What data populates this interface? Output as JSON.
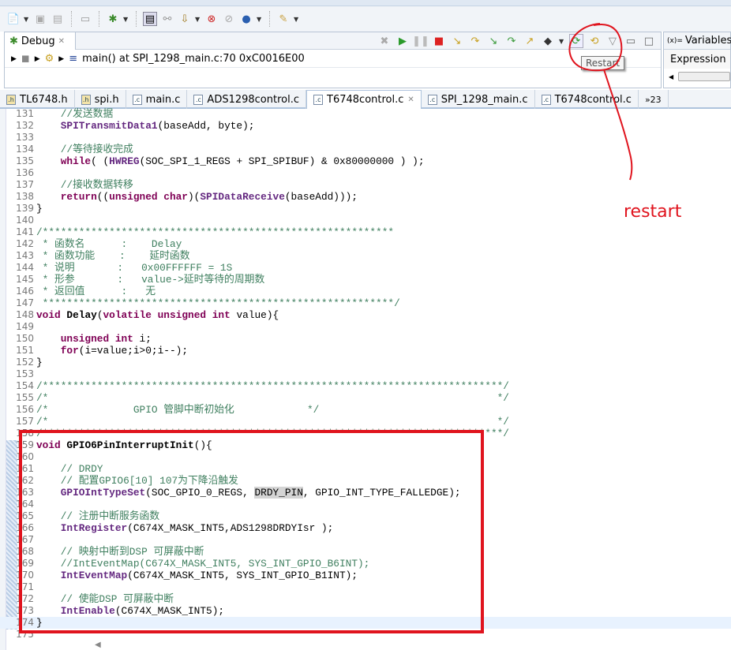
{
  "toolbar": {
    "icons": [
      "new-file-icon",
      "save-icon",
      "save-all-icon",
      "properties-icon",
      "debug-icon",
      "perspective-icon",
      "connect-icon",
      "load-program-icon",
      "breakpoint-icon",
      "disable-breakpoint-icon",
      "target-icon",
      "tools-icon"
    ]
  },
  "debug": {
    "title": "Debug",
    "stack_frame": "main() at SPI_1298_main.c:70 0xC0016E00",
    "restart_tooltip": "Restart"
  },
  "variables": {
    "title": "Variables",
    "column": "Expression"
  },
  "tabs": [
    {
      "label": "TL6748.h",
      "type": "h"
    },
    {
      "label": "spi.h",
      "type": "h"
    },
    {
      "label": "main.c",
      "type": "c"
    },
    {
      "label": "ADS1298control.c",
      "type": "c"
    },
    {
      "label": "T6748control.c",
      "type": "c",
      "active": true
    },
    {
      "label": "SPI_1298_main.c",
      "type": "c"
    },
    {
      "label": "T6748control.c",
      "type": "c"
    }
  ],
  "tabs_overflow": "»23",
  "code": [
    {
      "n": "131",
      "s": [
        [
          "c",
          "    //发送数据"
        ]
      ]
    },
    {
      "n": "132",
      "s": [
        [
          "t",
          "    "
        ],
        [
          "f",
          "SPITransmitData1"
        ],
        [
          "t",
          "(baseAdd, byte);"
        ]
      ]
    },
    {
      "n": "133",
      "s": []
    },
    {
      "n": "134",
      "s": [
        [
          "c",
          "    //等待接收完成"
        ]
      ]
    },
    {
      "n": "135",
      "s": [
        [
          "t",
          "    "
        ],
        [
          "k",
          "while"
        ],
        [
          "t",
          "( ("
        ],
        [
          "f",
          "HWREG"
        ],
        [
          "t",
          "(SOC_SPI_1_REGS + SPI_SPIBUF) & 0x80000000 ) );"
        ]
      ]
    },
    {
      "n": "136",
      "s": []
    },
    {
      "n": "137",
      "s": [
        [
          "c",
          "    //接收数据转移"
        ]
      ]
    },
    {
      "n": "138",
      "s": [
        [
          "t",
          "    "
        ],
        [
          "k",
          "return"
        ],
        [
          "t",
          "(("
        ],
        [
          "k",
          "unsigned char"
        ],
        [
          "t",
          ")("
        ],
        [
          "f",
          "SPIDataReceive"
        ],
        [
          "t",
          "(baseAdd)));"
        ]
      ]
    },
    {
      "n": "139",
      "s": [
        [
          "t",
          "}"
        ]
      ]
    },
    {
      "n": "140",
      "s": []
    },
    {
      "n": "141",
      "s": [
        [
          "c",
          "/**********************************************************"
        ]
      ]
    },
    {
      "n": "142",
      "s": [
        [
          "c",
          " * 函数名      :    Delay"
        ]
      ]
    },
    {
      "n": "143",
      "s": [
        [
          "c",
          " * 函数功能    :    延时函数"
        ]
      ]
    },
    {
      "n": "144",
      "s": [
        [
          "c",
          " * 说明       :   0x00FFFFFF = 1S"
        ]
      ]
    },
    {
      "n": "145",
      "s": [
        [
          "c",
          " * 形参       :   value->延时等待的周期数"
        ]
      ]
    },
    {
      "n": "146",
      "s": [
        [
          "c",
          " * 返回值      :   无"
        ]
      ]
    },
    {
      "n": "147",
      "s": [
        [
          "c",
          " **********************************************************/"
        ]
      ]
    },
    {
      "n": "148",
      "s": [
        [
          "k",
          "void"
        ],
        [
          "t",
          " "
        ],
        [
          "b",
          "Delay"
        ],
        [
          "t",
          "("
        ],
        [
          "k",
          "volatile unsigned int"
        ],
        [
          "t",
          " value){"
        ]
      ]
    },
    {
      "n": "149",
      "s": []
    },
    {
      "n": "150",
      "s": [
        [
          "t",
          "    "
        ],
        [
          "k",
          "unsigned int"
        ],
        [
          "t",
          " i;"
        ]
      ]
    },
    {
      "n": "151",
      "s": [
        [
          "t",
          "    "
        ],
        [
          "k",
          "for"
        ],
        [
          "t",
          "(i=value;i>0;i--);"
        ]
      ]
    },
    {
      "n": "152",
      "s": [
        [
          "t",
          "}"
        ]
      ]
    },
    {
      "n": "153",
      "s": []
    },
    {
      "n": "154",
      "s": [
        [
          "c",
          "/****************************************************************************/"
        ]
      ]
    },
    {
      "n": "155",
      "s": [
        [
          "c",
          "/*                                                                          */"
        ]
      ]
    },
    {
      "n": "156",
      "s": [
        [
          "c",
          "/*              GPIO 管脚中断初始化            */"
        ]
      ]
    },
    {
      "n": "157",
      "s": [
        [
          "c",
          "/*                                                                          */"
        ]
      ]
    },
    {
      "n": "158",
      "s": [
        [
          "c",
          "/****************************************************************************/"
        ]
      ]
    },
    {
      "n": "159",
      "s": [
        [
          "k",
          "void"
        ],
        [
          "t",
          " "
        ],
        [
          "b",
          "GPIO6PinInterruptInit"
        ],
        [
          "t",
          "(){"
        ]
      ]
    },
    {
      "n": "160",
      "s": []
    },
    {
      "n": "161",
      "s": [
        [
          "c",
          "    // DRDY"
        ]
      ]
    },
    {
      "n": "162",
      "s": [
        [
          "c",
          "    // 配置GPIO6[10] 107为下降沿触发"
        ]
      ]
    },
    {
      "n": "163",
      "s": [
        [
          "t",
          "    "
        ],
        [
          "f",
          "GPIOIntTypeSet"
        ],
        [
          "t",
          "(SOC_GPIO_0_REGS, "
        ],
        [
          "hl",
          "DRDY_PIN"
        ],
        [
          "t",
          ", GPIO_INT_TYPE_FALLEDGE);"
        ]
      ]
    },
    {
      "n": "164",
      "s": []
    },
    {
      "n": "165",
      "s": [
        [
          "c",
          "    // 注册中断服务函数"
        ]
      ]
    },
    {
      "n": "166",
      "s": [
        [
          "t",
          "    "
        ],
        [
          "f",
          "IntRegister"
        ],
        [
          "t",
          "(C674X_MASK_INT5,ADS1298DRDYIsr );"
        ]
      ]
    },
    {
      "n": "167",
      "s": []
    },
    {
      "n": "168",
      "s": [
        [
          "c",
          "    // 映射中断到DSP 可屏蔽中断"
        ]
      ]
    },
    {
      "n": "169",
      "s": [
        [
          "c",
          "    //IntEventMap(C674X_MASK_INT5, SYS_INT_GPIO_B6INT);"
        ]
      ]
    },
    {
      "n": "170",
      "s": [
        [
          "t",
          "    "
        ],
        [
          "f",
          "IntEventMap"
        ],
        [
          "t",
          "(C674X_MASK_INT5, SYS_INT_GPIO_B1INT);"
        ]
      ]
    },
    {
      "n": "171",
      "s": []
    },
    {
      "n": "172",
      "s": [
        [
          "c",
          "    // 使能DSP 可屏蔽中断"
        ]
      ]
    },
    {
      "n": "173",
      "s": [
        [
          "t",
          "    "
        ],
        [
          "f",
          "IntEnable"
        ],
        [
          "t",
          "(C674X_MASK_INT5);"
        ]
      ]
    },
    {
      "n": "174",
      "s": [
        [
          "t",
          "}"
        ]
      ],
      "current": true
    },
    {
      "n": "175",
      "s": []
    }
  ],
  "annotation": {
    "label": "restart",
    "color": "#e0141e"
  },
  "colors": {
    "keyword": "#7f0055",
    "comment": "#3f7f5f",
    "annotation": "#e0141e"
  }
}
